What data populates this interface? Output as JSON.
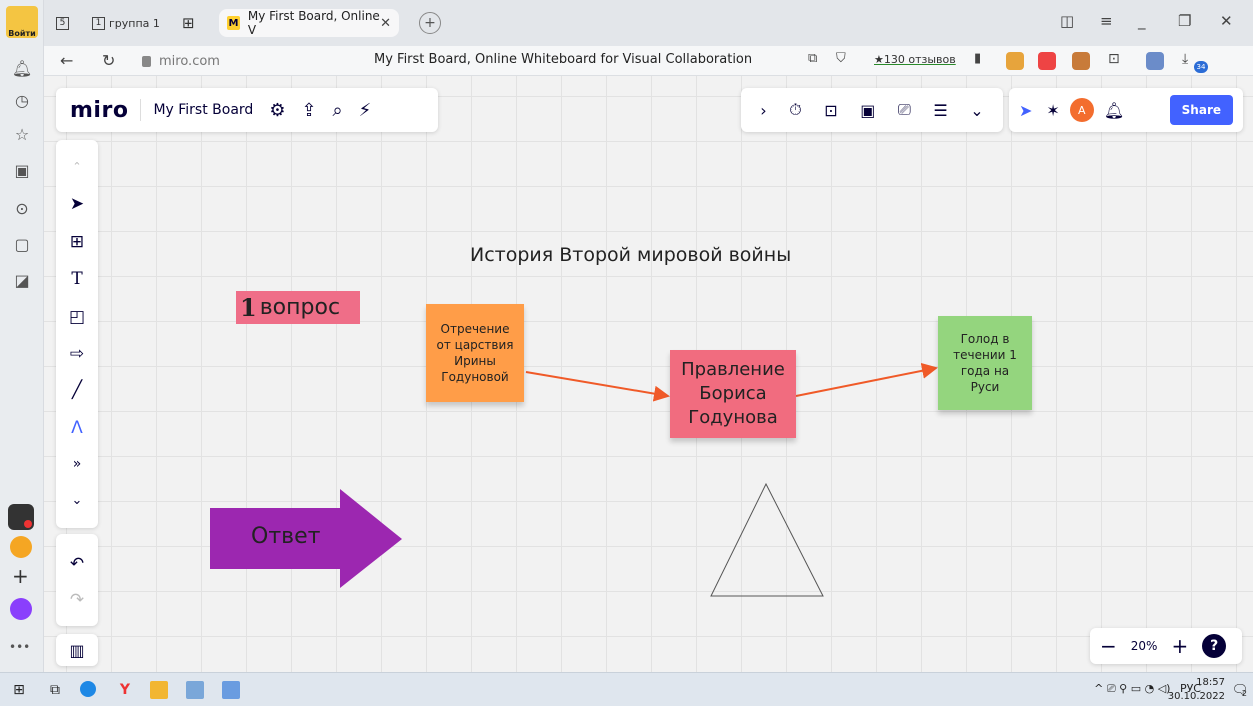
{
  "browser": {
    "profile_label": "Войти",
    "tabs": [
      {
        "label": "группа 1",
        "number": "1"
      },
      {
        "label": "My First Board, Online V",
        "active": true
      }
    ],
    "home_badge": "5",
    "url": "miro.com",
    "page_title": "My First Board, Online Whiteboard for Visual Collaboration",
    "reviews": "★130 отзывов",
    "download_badge": "34"
  },
  "miro": {
    "logo": "miro",
    "board_name": "My First Board",
    "avatar_initial": "A",
    "share_label": "Share",
    "zoom_level": "20%",
    "help_label": "?"
  },
  "board": {
    "title": "История Второй мировой войны",
    "question_num": "1",
    "question_text": "вопрос",
    "sticky_orange": [
      "Отречение",
      "от царствия",
      "Ирины",
      "Годуновой"
    ],
    "sticky_pink": [
      "Правление",
      "Бориса",
      "Годунова"
    ],
    "sticky_green": [
      "Голод в",
      "течении 1",
      "года на",
      "Руси"
    ],
    "answer": "Ответ",
    "colors": {
      "orange": "#ff9d48",
      "pink": "#f16c7f",
      "green": "#94d57e",
      "purple_arrow": "#9c27b0",
      "connector": "#f05a28",
      "label_pink": "#ef6e88"
    }
  },
  "taskbar": {
    "language": "РУС",
    "time": "18:57",
    "date": "30.10.2022",
    "notif_count": "2"
  }
}
